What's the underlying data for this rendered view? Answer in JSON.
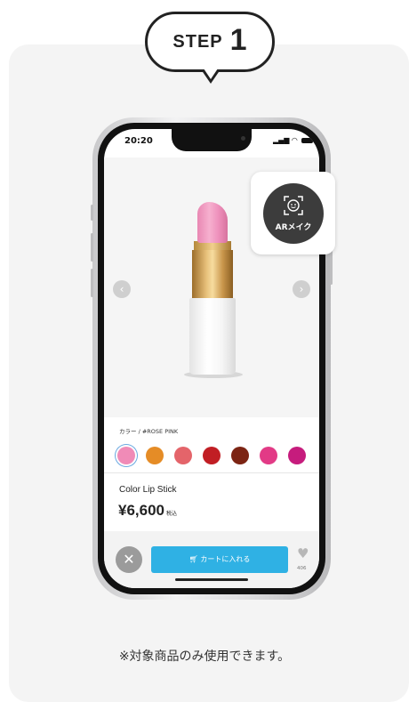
{
  "step": {
    "word": "STEP",
    "number": "1"
  },
  "phone": {
    "status_time": "20:20",
    "ar_button_label": "ARメイク",
    "color_label": "カラー / #ROSE PINK",
    "swatches": [
      {
        "color": "#f08bb7",
        "selected": true
      },
      {
        "color": "#e58c26"
      },
      {
        "color": "#e4646a"
      },
      {
        "color": "#c11e24"
      },
      {
        "color": "#7c2413"
      },
      {
        "color": "#e23a86"
      },
      {
        "color": "#c61c7d"
      }
    ],
    "product_name": "Color Lip Stick",
    "price": "¥6,600",
    "tax_label": "税込",
    "cart_button_label": "カートに入れる",
    "favorite_count": "406"
  },
  "note": "※対象商品のみ使用できます。"
}
